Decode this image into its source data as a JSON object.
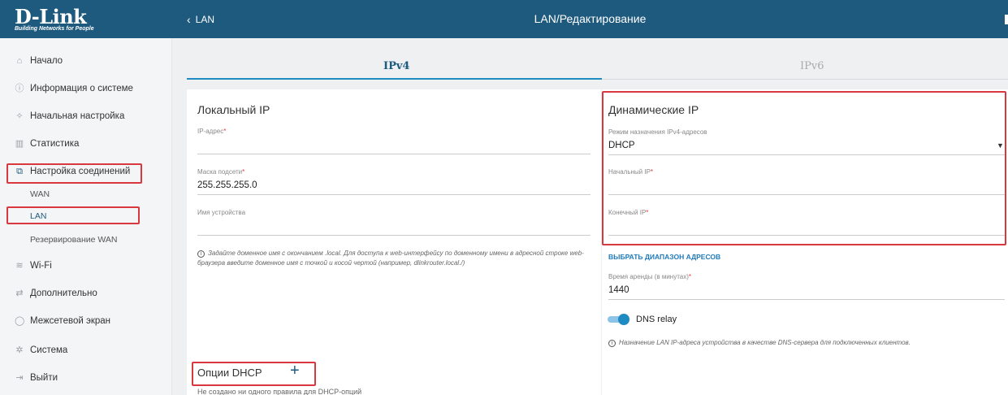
{
  "brand": {
    "name": "D-Link",
    "tagline": "Building Networks for People"
  },
  "header": {
    "back_label": "LAN",
    "title": "LAN/Редактирование"
  },
  "sidebar": {
    "items": [
      {
        "label": "Начало",
        "icon": "home-icon"
      },
      {
        "label": "Информация о системе",
        "icon": "info-icon"
      },
      {
        "label": "Начальная настройка",
        "icon": "wand-icon"
      },
      {
        "label": "Статистика",
        "icon": "chart-icon"
      },
      {
        "label": "Настройка соединений",
        "icon": "connections-icon"
      },
      {
        "label": "Wi-Fi",
        "icon": "wifi-icon"
      },
      {
        "label": "Дополнительно",
        "icon": "sliders-icon"
      },
      {
        "label": "Межсетевой экран",
        "icon": "shield-icon"
      },
      {
        "label": "Система",
        "icon": "gear-icon"
      },
      {
        "label": "Выйти",
        "icon": "logout-icon"
      }
    ],
    "subitems": [
      {
        "label": "WAN"
      },
      {
        "label": "LAN"
      },
      {
        "label": "Резервирование WAN"
      }
    ]
  },
  "tabs": [
    {
      "label": "IPv4"
    },
    {
      "label": "IPv6"
    }
  ],
  "local_ip": {
    "title": "Локальный IP",
    "ip_label": "IP-адрес",
    "ip_value": "",
    "mask_label": "Маска подсети",
    "mask_value": "255.255.255.0",
    "device_label": "Имя устройства",
    "device_value": "",
    "hint": "Задайте доменное имя с окончанием .local. Для доступа к web-интерфейсу по доменному имени в адресной строке web-браузера введите доменное имя с точкой и косой чертой (например, dlinkrouter.local./)"
  },
  "dynamic_ip": {
    "title": "Динамические IP",
    "mode_label": "Режим назначения IPv4-адресов",
    "mode_value": "DHCP",
    "start_label": "Начальный IP",
    "start_value": "",
    "end_label": "Конечный IP",
    "end_value": "",
    "range_link": "ВЫБРАТЬ ДИАПАЗОН АДРЕСОВ",
    "lease_label": "Время аренды (в минутах)",
    "lease_value": "1440",
    "dns_relay_label": "DNS relay",
    "dns_relay_enabled": true,
    "dns_hint": "Назначение LAN IP-адреса устройства в качестве DNS-сервера для подключенных клиентов."
  },
  "dhcp_options": {
    "title": "Опции DHCP",
    "empty_text": "Не создано ни одного правила для DHCP-опций"
  },
  "colors": {
    "header_bg": "#1e5a7e",
    "accent": "#1e8bc3",
    "highlight": "#d9383e",
    "required": "#e53935"
  }
}
